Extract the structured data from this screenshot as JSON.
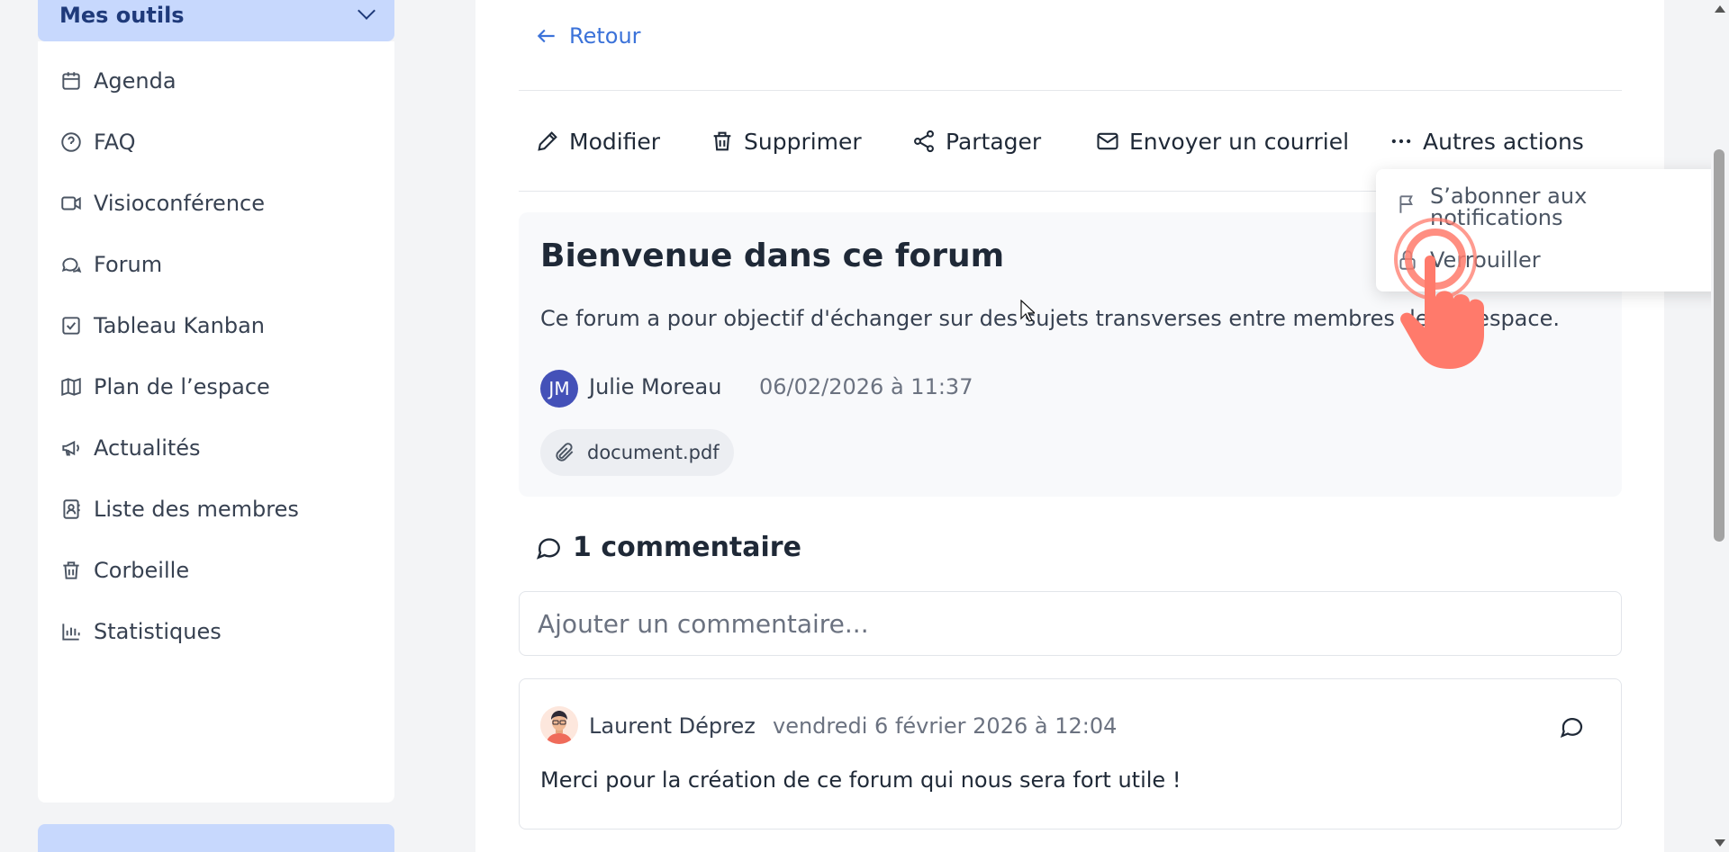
{
  "sidebar": {
    "section_title": "Mes outils",
    "items": [
      {
        "label": "Agenda",
        "icon": "calendar-icon"
      },
      {
        "label": "FAQ",
        "icon": "help-circle-icon"
      },
      {
        "label": "Visioconférence",
        "icon": "video-icon"
      },
      {
        "label": "Forum",
        "icon": "chat-bubbles-icon"
      },
      {
        "label": "Tableau Kanban",
        "icon": "checkbox-icon"
      },
      {
        "label": "Plan de l’espace",
        "icon": "map-icon"
      },
      {
        "label": "Actualités",
        "icon": "megaphone-icon"
      },
      {
        "label": "Liste des membres",
        "icon": "contact-book-icon"
      },
      {
        "label": "Corbeille",
        "icon": "trash-icon"
      },
      {
        "label": "Statistiques",
        "icon": "bar-chart-icon"
      }
    ]
  },
  "nav": {
    "back_label": "Retour"
  },
  "actions": {
    "edit": "Modifier",
    "delete": "Supprimer",
    "share": "Partager",
    "email": "Envoyer un courriel",
    "more": "Autres actions"
  },
  "dropdown": {
    "subscribe_line1": "S’abonner aux",
    "subscribe_line2": "notifications",
    "lock": "Verrouiller"
  },
  "post": {
    "title": "Bienvenue dans ce forum",
    "description": "Ce forum a pour objectif d'échanger sur des sujets transverses entre membres de cet espace.",
    "author_initials": "JM",
    "author_name": "Julie Moreau",
    "date": "06/02/2026 à 11:37",
    "attachment": "document.pdf"
  },
  "comments": {
    "heading": "1 commentaire",
    "input_placeholder": "Ajouter un commentaire...",
    "items": [
      {
        "author": "Laurent Déprez",
        "date": "vendredi 6 février 2026 à 12:04",
        "text": "Merci pour la création de ce forum qui nous sera fort utile !"
      }
    ]
  },
  "colors": {
    "accent": "#3b72d9",
    "sidebar_header_bg": "#c7d8fd",
    "avatar_bg": "#4451b8",
    "touch_indicator": "#ff7a6b"
  }
}
